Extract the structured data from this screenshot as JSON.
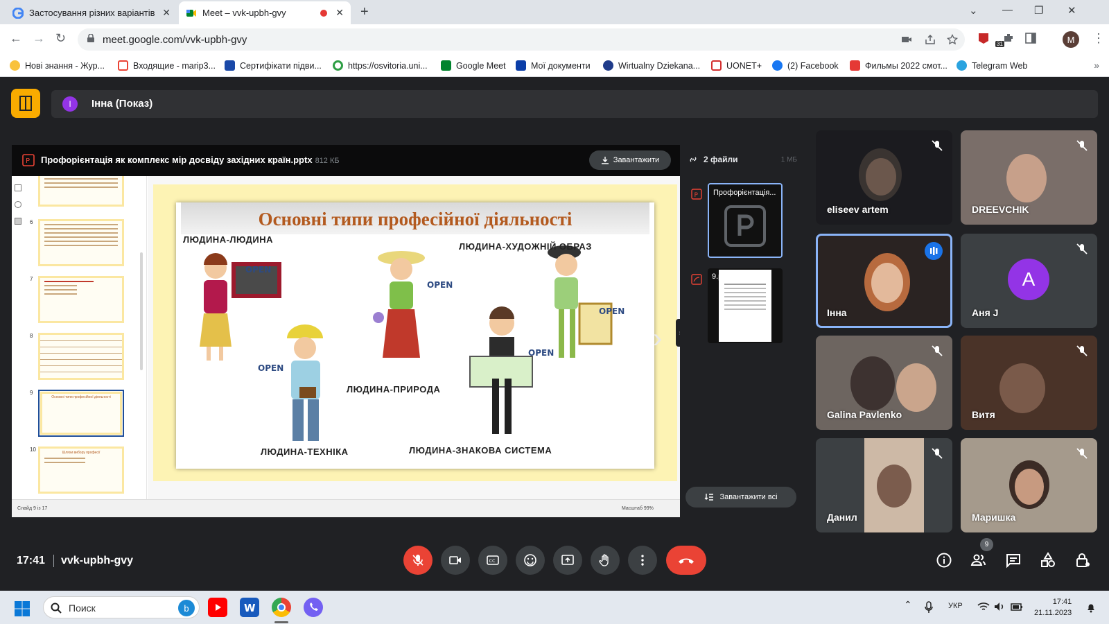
{
  "browser": {
    "tabs": [
      {
        "title": "Застосування різних варіантів ",
        "active": false
      },
      {
        "title": "Meet – vvk-upbh-gvy",
        "active": true
      }
    ],
    "url": "meet.google.com/vvk-upbh-gvy",
    "profile_initial": "M",
    "extension_badge": "31",
    "bookmarks": [
      {
        "label": "Нові знання - Жур..."
      },
      {
        "label": "Входящие - marip3..."
      },
      {
        "label": "Сертифікати підви..."
      },
      {
        "label": "https://osvitoria.uni..."
      },
      {
        "label": "Google Meet"
      },
      {
        "label": "Мої документи"
      },
      {
        "label": "Wirtualny Dziekana..."
      },
      {
        "label": "UONET+"
      },
      {
        "label": "(2) Facebook"
      },
      {
        "label": "Фильмы 2022 смот..."
      },
      {
        "label": "Telegram Web"
      }
    ]
  },
  "meet": {
    "presenter_initial": "І",
    "presenter_label": "Інна (Показ)",
    "file": {
      "name": "Профорієнтація як комплекс мір досвіду західних країн.pptx",
      "size": "812 КБ",
      "download_label": "Завантажити"
    },
    "slide": {
      "title": "Основні типи професійної діяльності",
      "labels": [
        "ЛЮДИНА-ЛЮДИНА",
        "ЛЮДИНА-ХУДОЖНІЙ ОБРАЗ",
        "ЛЮДИНА-ПРИРОДА",
        "ЛЮДИНА-ТЕХНІКА",
        "ЛЮДИНА-ЗНАКОВА СИСТЕМА"
      ],
      "tag": "OPEN",
      "status": "Слайд 9 із 17",
      "zoom": "Масштаб 99%"
    },
    "thumb_numbers": [
      "6",
      "7",
      "8",
      "9",
      "10"
    ],
    "thumb_titles": [
      "Основні типи професійної діяльності",
      "Шляхи вибору професії"
    ],
    "files": {
      "header": "2 файли",
      "size": "1 МБ",
      "items": [
        {
          "name": "Профорієнтація..."
        },
        {
          "name": "9.pdf"
        }
      ],
      "download_all_label": "Завантажити всі"
    },
    "participants": [
      {
        "name": "eliseev artem"
      },
      {
        "name": "DREEVCHIK"
      },
      {
        "name": "Інна"
      },
      {
        "name": "Аня J",
        "initial": "A"
      },
      {
        "name": "Galina Pavlenko"
      },
      {
        "name": "Витя"
      },
      {
        "name": "Данил"
      },
      {
        "name": "Маришка"
      }
    ],
    "time": "17:41",
    "code": "vvk-upbh-gvy",
    "people_count": "9"
  },
  "taskbar": {
    "search_placeholder": "Поиск",
    "lang": "УКР",
    "time": "17:41",
    "date": "21.11.2023"
  }
}
